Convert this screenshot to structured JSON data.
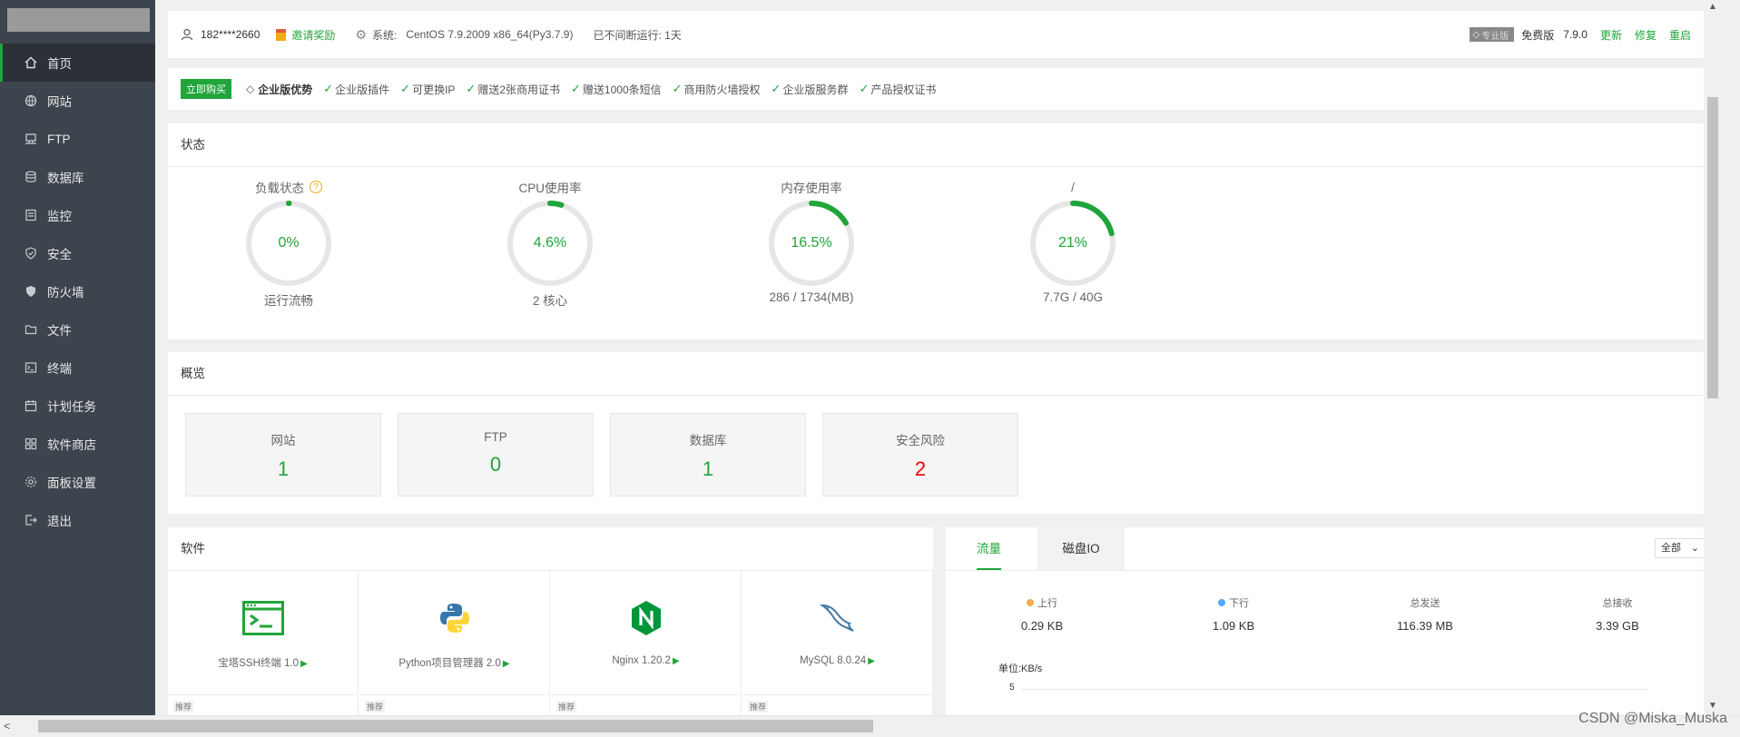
{
  "sidebar": {
    "items": [
      {
        "label": "首页",
        "icon": "home-icon",
        "active": true
      },
      {
        "label": "网站",
        "icon": "globe-icon"
      },
      {
        "label": "FTP",
        "icon": "ftp-icon"
      },
      {
        "label": "数据库",
        "icon": "database-icon"
      },
      {
        "label": "监控",
        "icon": "monitor-icon"
      },
      {
        "label": "安全",
        "icon": "shield-icon"
      },
      {
        "label": "防火墙",
        "icon": "firewall-icon"
      },
      {
        "label": "文件",
        "icon": "folder-icon"
      },
      {
        "label": "终端",
        "icon": "terminal-icon"
      },
      {
        "label": "计划任务",
        "icon": "calendar-icon"
      },
      {
        "label": "软件商店",
        "icon": "apps-icon"
      },
      {
        "label": "面板设置",
        "icon": "settings-icon"
      },
      {
        "label": "退出",
        "icon": "logout-icon"
      }
    ]
  },
  "topbar": {
    "user": "182****2660",
    "invite": "邀请奖励",
    "sys_label": "系统:",
    "sys_value": "CentOS 7.9.2009 x86_64(Py3.7.9)",
    "uptime": "已不间断运行: 1天",
    "pro_badge": "专业版",
    "edition": "免费版",
    "version": "7.9.0",
    "update": "更新",
    "repair": "修复",
    "restart": "重启"
  },
  "enterprise": {
    "buy": "立即购买",
    "title": "企业版优势",
    "features": [
      "企业版插件",
      "可更换IP",
      "赠送2张商用证书",
      "赠送1000条短信",
      "商用防火墙授权",
      "企业版服务群",
      "产品授权证书"
    ]
  },
  "status": {
    "title": "状态",
    "gauges": [
      {
        "title": "负载状态",
        "value": "0%",
        "percent": 0,
        "sub": "运行流畅",
        "help": "?"
      },
      {
        "title": "CPU使用率",
        "value": "4.6%",
        "percent": 4.6,
        "sub": "2 核心"
      },
      {
        "title": "内存使用率",
        "value": "16.5%",
        "percent": 16.5,
        "sub": "286 / 1734(MB)"
      },
      {
        "title": "/",
        "value": "21%",
        "percent": 21,
        "sub": "7.7G / 40G"
      }
    ],
    "colors": {
      "track": "#e6e6e6",
      "fill": "#20a53a"
    }
  },
  "overview": {
    "title": "概览",
    "boxes": [
      {
        "label": "网站",
        "value": "1"
      },
      {
        "label": "FTP",
        "value": "0"
      },
      {
        "label": "数据库",
        "value": "1"
      },
      {
        "label": "安全风险",
        "value": "2"
      }
    ]
  },
  "software": {
    "title": "软件",
    "items": [
      {
        "name": "宝塔SSH终端 1.0",
        "icon": "terminal-app-icon"
      },
      {
        "name": "Python项目管理器 2.0",
        "icon": "python-icon"
      },
      {
        "name": "Nginx 1.20.2",
        "icon": "nginx-icon"
      },
      {
        "name": "MySQL 8.0.24",
        "icon": "mysql-icon"
      }
    ],
    "recommend": "推荐"
  },
  "flow": {
    "tabs": [
      "流量",
      "磁盘IO"
    ],
    "select": "全部",
    "stats": [
      {
        "label": "上行",
        "value": "0.29 KB",
        "dot": "#f0ad4e"
      },
      {
        "label": "下行",
        "value": "1.09 KB",
        "dot": "#52a9ff"
      },
      {
        "label": "总发送",
        "value": "116.39 MB"
      },
      {
        "label": "总接收",
        "value": "3.39 GB"
      }
    ],
    "unit": "单位:KB/s",
    "y_tick": "5"
  },
  "watermark": "CSDN @Miska_Muska"
}
